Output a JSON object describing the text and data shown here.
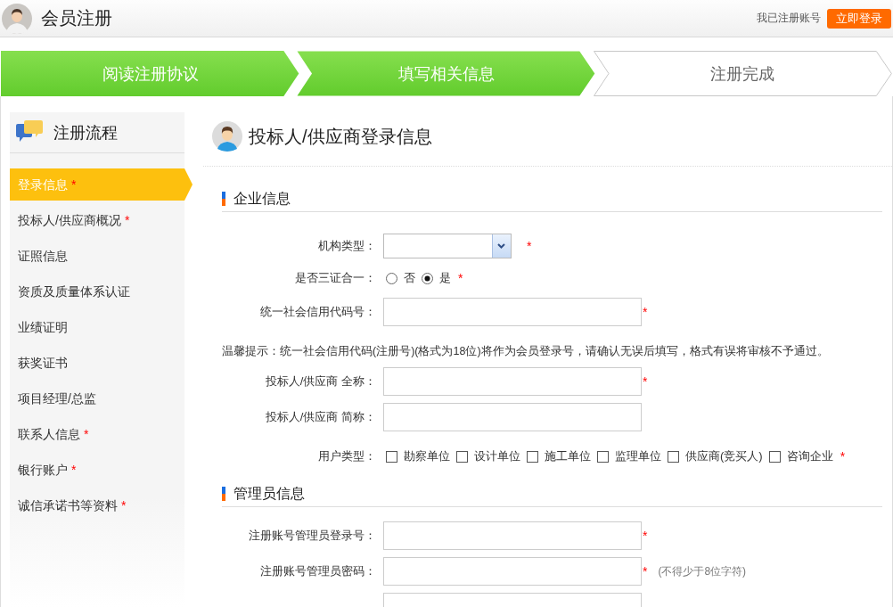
{
  "header": {
    "title": "会员注册",
    "prompt": "我已注册账号",
    "login_button": "立即登录"
  },
  "steps": [
    {
      "label": "阅读注册协议",
      "active": true
    },
    {
      "label": "填写相关信息",
      "active": true
    },
    {
      "label": "注册完成",
      "active": false
    }
  ],
  "sidebar": {
    "title": "注册流程",
    "items": [
      {
        "label": "登录信息",
        "mark": "*",
        "selected": true
      },
      {
        "label": "投标人/供应商概况",
        "mark": "*",
        "selected": false
      },
      {
        "label": "证照信息",
        "selected": false
      },
      {
        "label": "资质及质量体系认证",
        "selected": false
      },
      {
        "label": "业绩证明",
        "selected": false
      },
      {
        "label": "获奖证书",
        "selected": false
      },
      {
        "label": "项目经理/总监",
        "selected": false
      },
      {
        "label": "联系人信息",
        "mark": "*",
        "selected": false
      },
      {
        "label": "银行账户",
        "mark": "*",
        "selected": false
      },
      {
        "label": "诚信承诺书等资料",
        "mark": "*",
        "selected": false
      }
    ]
  },
  "form": {
    "title": "投标人/供应商登录信息",
    "sections": [
      {
        "heading": "企业信息",
        "rows": [
          {
            "kind": "select",
            "label": "机构类型：",
            "mark": "*"
          },
          {
            "kind": "radio",
            "label": "是否三证合一：",
            "options": [
              {
                "label": "否",
                "selected": false
              },
              {
                "label": "是",
                "selected": true
              }
            ],
            "mark": "*"
          },
          {
            "kind": "text",
            "label": "统一社会信用代码号：",
            "mark": "*"
          },
          {
            "kind": "tip",
            "text": "温馨提示：统一社会信用代码(注册号)(格式为18位)将作为会员登录号，请确认无误后填写，格式有误将审核不予通过。"
          },
          {
            "kind": "text",
            "label": "投标人/供应商 全称：",
            "mark": "*"
          },
          {
            "kind": "text",
            "label": "投标人/供应商 简称："
          },
          {
            "kind": "checkbox",
            "label": "用户类型：",
            "options": [
              {
                "label": "勘察单位",
                "checked": false
              },
              {
                "label": "设计单位",
                "checked": false
              },
              {
                "label": "施工单位",
                "checked": false
              },
              {
                "label": "监理单位",
                "checked": false
              },
              {
                "label": "供应商(竞买人)",
                "checked": false
              },
              {
                "label": "咨询企业",
                "checked": false
              }
            ],
            "mark": "*"
          }
        ]
      },
      {
        "heading": "管理员信息",
        "rows": [
          {
            "kind": "text",
            "label": "注册账号管理员登录号：",
            "mark": "*"
          },
          {
            "kind": "text",
            "label": "注册账号管理员密码：",
            "mark": "*",
            "hint": "(不得少于8位字符)"
          },
          {
            "kind": "text"
          }
        ]
      }
    ]
  }
}
